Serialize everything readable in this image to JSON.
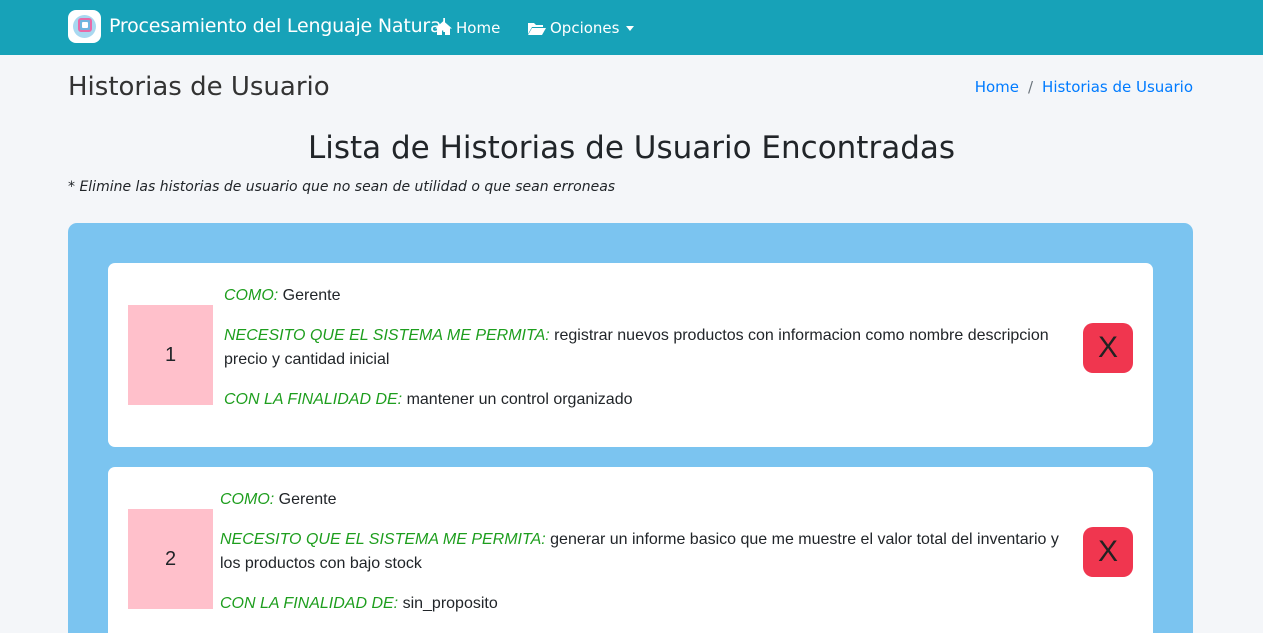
{
  "navbar": {
    "brand": "Procesamiento del Lenguaje Natural",
    "home_label": "Home",
    "options_label": "Opciones",
    "icons": {
      "home": "home-icon",
      "options": "folder-open-icon"
    }
  },
  "header": {
    "title": "Historias de Usuario",
    "breadcrumb": [
      "Home",
      "Historias de Usuario"
    ]
  },
  "main": {
    "heading": "Lista de Historias de Usuario Encontradas",
    "note": "* Elimine las historias de usuario que no sean de utilidad o que sean erroneas",
    "labels": {
      "como": "COMO:",
      "necesito": "NECESITO QUE EL SISTEMA ME PERMITA:",
      "finalidad": "CON LA FINALIDAD DE:"
    },
    "delete_label": "X",
    "stories": [
      {
        "number": "1",
        "como": "Gerente",
        "necesito": "registrar nuevos productos con informacion como nombre descripcion precio y cantidad inicial",
        "finalidad": "mantener un control organizado"
      },
      {
        "number": "2",
        "como": "Gerente",
        "necesito": "generar un informe basico que me muestre el valor total del inventario y los productos con bajo stock",
        "finalidad": "sin_proposito"
      }
    ]
  },
  "colors": {
    "navbar": "#17a2b8",
    "panel": "#7bc4f0",
    "number_box": "#ffc0cb",
    "label_green": "#1e9e1e",
    "delete_button": "#f0364f",
    "link": "#007bff"
  }
}
